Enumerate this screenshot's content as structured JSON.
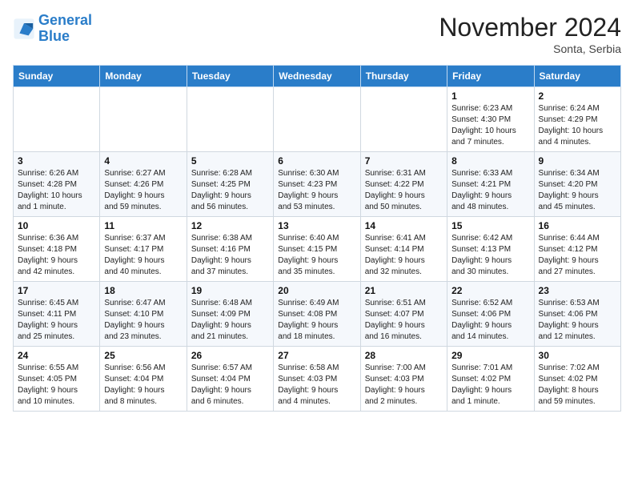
{
  "logo": {
    "line1": "General",
    "line2": "Blue"
  },
  "title": "November 2024",
  "location": "Sonta, Serbia",
  "weekdays": [
    "Sunday",
    "Monday",
    "Tuesday",
    "Wednesday",
    "Thursday",
    "Friday",
    "Saturday"
  ],
  "weeks": [
    [
      {
        "day": "",
        "info": ""
      },
      {
        "day": "",
        "info": ""
      },
      {
        "day": "",
        "info": ""
      },
      {
        "day": "",
        "info": ""
      },
      {
        "day": "",
        "info": ""
      },
      {
        "day": "1",
        "info": "Sunrise: 6:23 AM\nSunset: 4:30 PM\nDaylight: 10 hours\nand 7 minutes."
      },
      {
        "day": "2",
        "info": "Sunrise: 6:24 AM\nSunset: 4:29 PM\nDaylight: 10 hours\nand 4 minutes."
      }
    ],
    [
      {
        "day": "3",
        "info": "Sunrise: 6:26 AM\nSunset: 4:28 PM\nDaylight: 10 hours\nand 1 minute."
      },
      {
        "day": "4",
        "info": "Sunrise: 6:27 AM\nSunset: 4:26 PM\nDaylight: 9 hours\nand 59 minutes."
      },
      {
        "day": "5",
        "info": "Sunrise: 6:28 AM\nSunset: 4:25 PM\nDaylight: 9 hours\nand 56 minutes."
      },
      {
        "day": "6",
        "info": "Sunrise: 6:30 AM\nSunset: 4:23 PM\nDaylight: 9 hours\nand 53 minutes."
      },
      {
        "day": "7",
        "info": "Sunrise: 6:31 AM\nSunset: 4:22 PM\nDaylight: 9 hours\nand 50 minutes."
      },
      {
        "day": "8",
        "info": "Sunrise: 6:33 AM\nSunset: 4:21 PM\nDaylight: 9 hours\nand 48 minutes."
      },
      {
        "day": "9",
        "info": "Sunrise: 6:34 AM\nSunset: 4:20 PM\nDaylight: 9 hours\nand 45 minutes."
      }
    ],
    [
      {
        "day": "10",
        "info": "Sunrise: 6:36 AM\nSunset: 4:18 PM\nDaylight: 9 hours\nand 42 minutes."
      },
      {
        "day": "11",
        "info": "Sunrise: 6:37 AM\nSunset: 4:17 PM\nDaylight: 9 hours\nand 40 minutes."
      },
      {
        "day": "12",
        "info": "Sunrise: 6:38 AM\nSunset: 4:16 PM\nDaylight: 9 hours\nand 37 minutes."
      },
      {
        "day": "13",
        "info": "Sunrise: 6:40 AM\nSunset: 4:15 PM\nDaylight: 9 hours\nand 35 minutes."
      },
      {
        "day": "14",
        "info": "Sunrise: 6:41 AM\nSunset: 4:14 PM\nDaylight: 9 hours\nand 32 minutes."
      },
      {
        "day": "15",
        "info": "Sunrise: 6:42 AM\nSunset: 4:13 PM\nDaylight: 9 hours\nand 30 minutes."
      },
      {
        "day": "16",
        "info": "Sunrise: 6:44 AM\nSunset: 4:12 PM\nDaylight: 9 hours\nand 27 minutes."
      }
    ],
    [
      {
        "day": "17",
        "info": "Sunrise: 6:45 AM\nSunset: 4:11 PM\nDaylight: 9 hours\nand 25 minutes."
      },
      {
        "day": "18",
        "info": "Sunrise: 6:47 AM\nSunset: 4:10 PM\nDaylight: 9 hours\nand 23 minutes."
      },
      {
        "day": "19",
        "info": "Sunrise: 6:48 AM\nSunset: 4:09 PM\nDaylight: 9 hours\nand 21 minutes."
      },
      {
        "day": "20",
        "info": "Sunrise: 6:49 AM\nSunset: 4:08 PM\nDaylight: 9 hours\nand 18 minutes."
      },
      {
        "day": "21",
        "info": "Sunrise: 6:51 AM\nSunset: 4:07 PM\nDaylight: 9 hours\nand 16 minutes."
      },
      {
        "day": "22",
        "info": "Sunrise: 6:52 AM\nSunset: 4:06 PM\nDaylight: 9 hours\nand 14 minutes."
      },
      {
        "day": "23",
        "info": "Sunrise: 6:53 AM\nSunset: 4:06 PM\nDaylight: 9 hours\nand 12 minutes."
      }
    ],
    [
      {
        "day": "24",
        "info": "Sunrise: 6:55 AM\nSunset: 4:05 PM\nDaylight: 9 hours\nand 10 minutes."
      },
      {
        "day": "25",
        "info": "Sunrise: 6:56 AM\nSunset: 4:04 PM\nDaylight: 9 hours\nand 8 minutes."
      },
      {
        "day": "26",
        "info": "Sunrise: 6:57 AM\nSunset: 4:04 PM\nDaylight: 9 hours\nand 6 minutes."
      },
      {
        "day": "27",
        "info": "Sunrise: 6:58 AM\nSunset: 4:03 PM\nDaylight: 9 hours\nand 4 minutes."
      },
      {
        "day": "28",
        "info": "Sunrise: 7:00 AM\nSunset: 4:03 PM\nDaylight: 9 hours\nand 2 minutes."
      },
      {
        "day": "29",
        "info": "Sunrise: 7:01 AM\nSunset: 4:02 PM\nDaylight: 9 hours\nand 1 minute."
      },
      {
        "day": "30",
        "info": "Sunrise: 7:02 AM\nSunset: 4:02 PM\nDaylight: 8 hours\nand 59 minutes."
      }
    ]
  ]
}
